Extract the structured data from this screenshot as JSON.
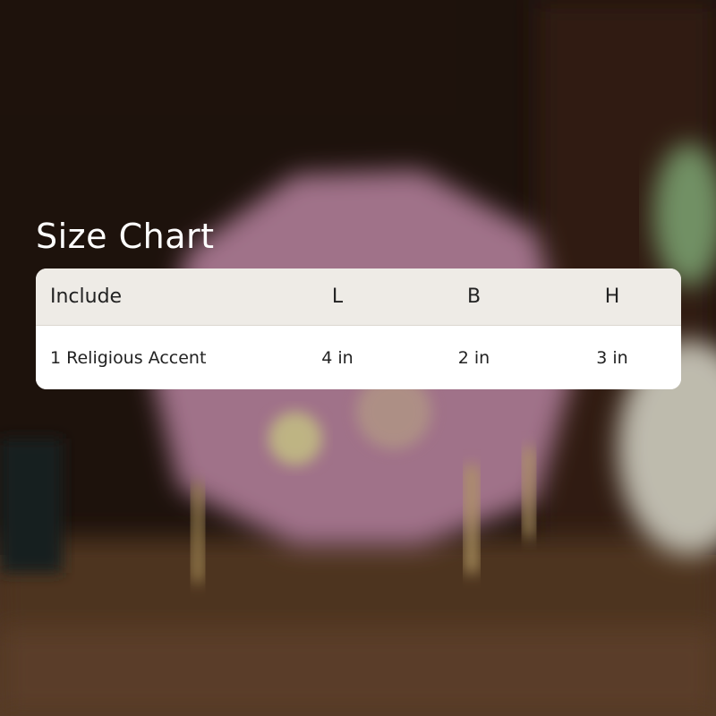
{
  "title": "Size Chart",
  "table": {
    "headers": [
      "Include",
      "L",
      "B",
      "H"
    ],
    "rows": [
      [
        "1 Religious Accent",
        "4 in",
        "2 in",
        "3 in"
      ]
    ]
  },
  "colors": {
    "header_bg": "#eeebe6",
    "row_bg": "#ffffff",
    "text": "#222222",
    "title_text": "#ffffff"
  }
}
